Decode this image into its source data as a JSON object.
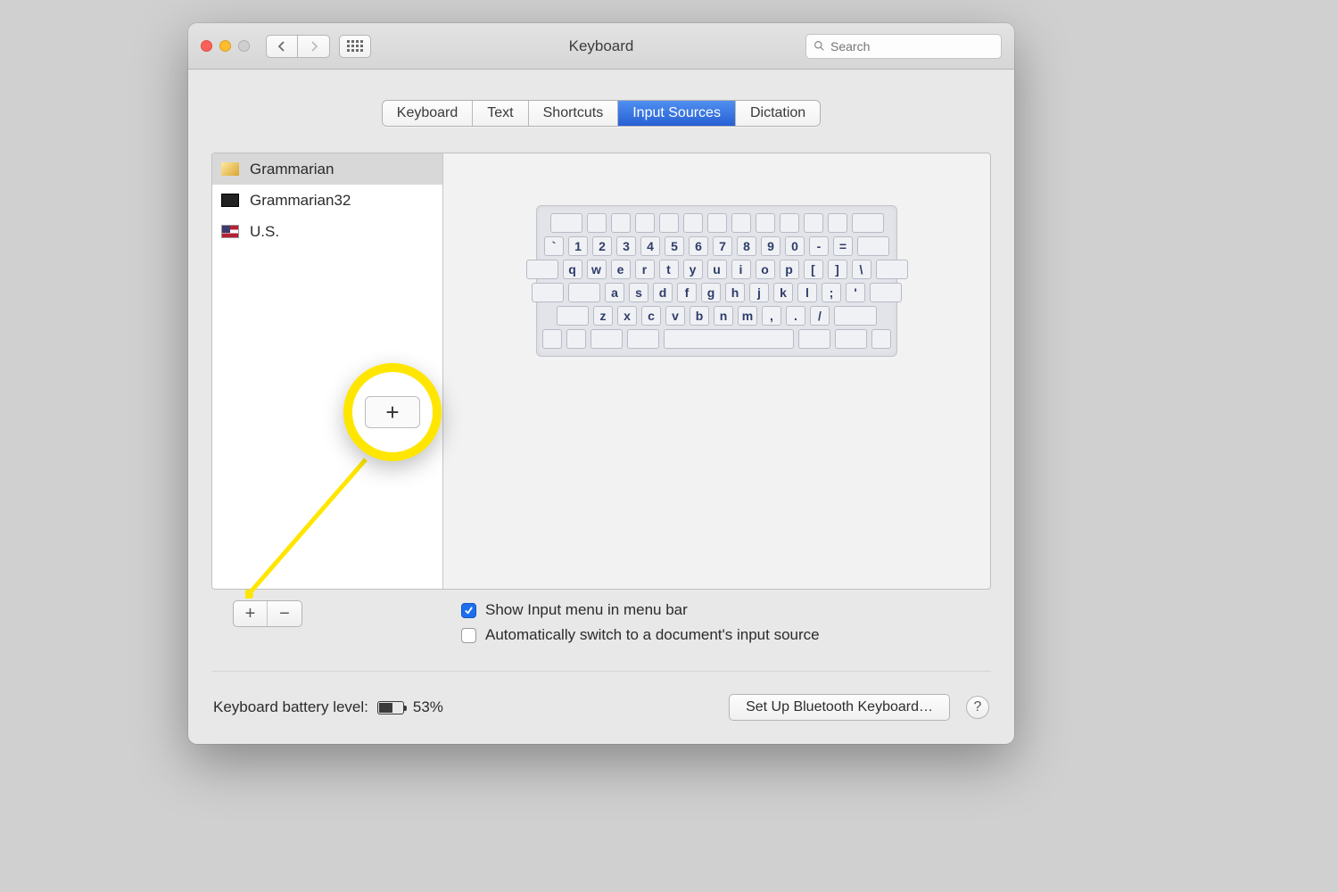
{
  "window": {
    "title": "Keyboard"
  },
  "search": {
    "placeholder": "Search"
  },
  "tabs": [
    "Keyboard",
    "Text",
    "Shortcuts",
    "Input Sources",
    "Dictation"
  ],
  "active_tab": "Input Sources",
  "sources": [
    {
      "name": "Grammarian",
      "icon": "pen",
      "selected": true
    },
    {
      "name": "Grammarian32",
      "icon": "sq",
      "selected": false
    },
    {
      "name": "U.S.",
      "icon": "us",
      "selected": false
    }
  ],
  "keyboard_rows": [
    [
      "`",
      "1",
      "2",
      "3",
      "4",
      "5",
      "6",
      "7",
      "8",
      "9",
      "0",
      "-",
      "="
    ],
    [
      "q",
      "w",
      "e",
      "r",
      "t",
      "y",
      "u",
      "i",
      "o",
      "p",
      "[",
      "]",
      "\\"
    ],
    [
      "a",
      "s",
      "d",
      "f",
      "g",
      "h",
      "j",
      "k",
      "l",
      ";",
      "'"
    ],
    [
      "z",
      "x",
      "c",
      "v",
      "b",
      "n",
      "m",
      ",",
      ".",
      "/"
    ]
  ],
  "add_label": "+",
  "remove_label": "−",
  "options": {
    "show_input_menu": {
      "label": "Show Input menu in menu bar",
      "checked": true
    },
    "auto_switch": {
      "label": "Automatically switch to a document's input source",
      "checked": false
    }
  },
  "footer": {
    "battery_label": "Keyboard battery level:",
    "battery_percent": "53%",
    "setup_button": "Set Up Bluetooth Keyboard…",
    "help": "?"
  },
  "callout_symbol": "+"
}
